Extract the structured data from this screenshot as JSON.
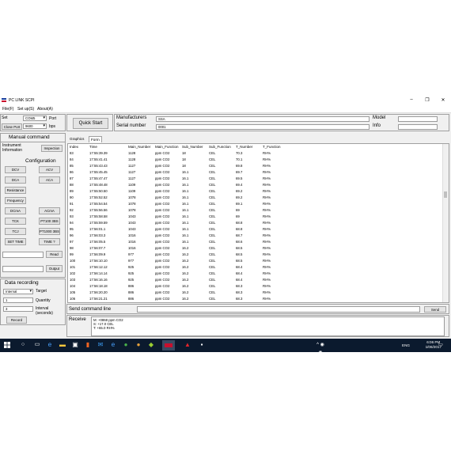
{
  "window": {
    "title": "PC LINK SCPI",
    "controls": [
      "–",
      "❐",
      "✕"
    ]
  },
  "menu": [
    "File(F)",
    "Set up(S)",
    "About(A)"
  ],
  "set_panel": {
    "set_label": "Set",
    "port_value": "COM5",
    "port_label": "Port",
    "close_port_button": "Close Port",
    "baud_value": "9600",
    "bps_label": "bps"
  },
  "quick_start_button": "Quick Start",
  "manufacturers_label": "Manufacturers",
  "manufacturers_value": "SSA",
  "serial_number_label": "Serial number",
  "serial_number_value": "0001",
  "model_label": "Model",
  "model_value": "",
  "info_label": "Info",
  "info_value": "",
  "manual_command": {
    "title": "Manual command",
    "instrument_info_label": "Instrument Information",
    "inspection_button": "Inspection",
    "configuration_title": "Configuration",
    "buttons": [
      "DCV",
      "ACV",
      "DCA",
      "ACA",
      "Resistance",
      "Frequency",
      "DCmA",
      "ACmA",
      "TCK",
      "PT100 3BS",
      "TCJ",
      "PT1000 3BS",
      "SET TIME",
      "TIME ?"
    ],
    "read_button": "Read",
    "output_button": "Output",
    "read_value": "",
    "output_value": ""
  },
  "data_recording": {
    "title": "Data recording",
    "target_value": "Internal",
    "target_label": "Target",
    "quantity_value": "1",
    "quantity_label": "Quantity",
    "interval_value": "3",
    "interval_label": "Interval (seconds)",
    "record_button": "Record"
  },
  "tabs": [
    "Graphics",
    "Form"
  ],
  "active_tab": "Form",
  "table": {
    "columns": [
      "Index",
      "Time",
      "Main_Number",
      "Main_Function",
      "Sub_Number",
      "Sub_Function",
      "T_Number",
      "T_Function"
    ],
    "rows": [
      [
        "83",
        "17:55:39.39",
        "1128",
        "ppm CO2",
        "18",
        "CEL",
        "70.3",
        "RH%"
      ],
      [
        "84",
        "17:55:41.41",
        "1128",
        "ppm CO2",
        "18",
        "CEL",
        "70.1",
        "RH%"
      ],
      [
        "85",
        "17:55:43.43",
        "1127",
        "ppm CO2",
        "18",
        "CEL",
        "69.8",
        "RH%"
      ],
      [
        "86",
        "17:55:45.45",
        "1127",
        "ppm CO2",
        "16.1",
        "CEL",
        "69.7",
        "RH%"
      ],
      [
        "87",
        "17:55:47.47",
        "1127",
        "ppm CO2",
        "16.1",
        "CEL",
        "69.5",
        "RH%"
      ],
      [
        "88",
        "17:55:48.48",
        "1109",
        "ppm CO2",
        "16.1",
        "CEL",
        "69.4",
        "RH%"
      ],
      [
        "89",
        "17:55:50.50",
        "1109",
        "ppm CO2",
        "16.1",
        "CEL",
        "69.2",
        "RH%"
      ],
      [
        "90",
        "17:55:52.52",
        "1078",
        "ppm CO2",
        "16.1",
        "CEL",
        "69.2",
        "RH%"
      ],
      [
        "91",
        "17:55:54.54",
        "1078",
        "ppm CO2",
        "16.1",
        "CEL",
        "69.1",
        "RH%"
      ],
      [
        "92",
        "17:55:56.56",
        "1078",
        "ppm CO2",
        "16.1",
        "CEL",
        "69",
        "RH%"
      ],
      [
        "93",
        "17:55:58.58",
        "1043",
        "ppm CO2",
        "16.1",
        "CEL",
        "69",
        "RH%"
      ],
      [
        "94",
        "17:55:59.59",
        "1043",
        "ppm CO2",
        "16.1",
        "CEL",
        "68.8",
        "RH%"
      ],
      [
        "95",
        "17:56:01.1",
        "1043",
        "ppm CO2",
        "16.1",
        "CEL",
        "68.8",
        "RH%"
      ],
      [
        "96",
        "17:56:03.3",
        "1016",
        "ppm CO2",
        "16.1",
        "CEL",
        "68.7",
        "RH%"
      ],
      [
        "97",
        "17:56:05.5",
        "1016",
        "ppm CO2",
        "16.1",
        "CEL",
        "68.6",
        "RH%"
      ],
      [
        "98",
        "17:56:07.7",
        "1016",
        "ppm CO2",
        "16.2",
        "CEL",
        "68.5",
        "RH%"
      ],
      [
        "99",
        "17:56:09.9",
        "977",
        "ppm CO2",
        "16.2",
        "CEL",
        "68.5",
        "RH%"
      ],
      [
        "100",
        "17:56:10.10",
        "977",
        "ppm CO2",
        "16.2",
        "CEL",
        "68.5",
        "RH%"
      ],
      [
        "101",
        "17:56:12.12",
        "925",
        "ppm CO2",
        "16.2",
        "CEL",
        "68.4",
        "RH%"
      ],
      [
        "102",
        "17:56:14.14",
        "925",
        "ppm CO2",
        "16.2",
        "CEL",
        "68.4",
        "RH%"
      ],
      [
        "103",
        "17:56:16.16",
        "925",
        "ppm CO2",
        "16.2",
        "CEL",
        "68.4",
        "RH%"
      ],
      [
        "104",
        "17:56:18.18",
        "886",
        "ppm CO2",
        "16.2",
        "CEL",
        "68.3",
        "RH%"
      ],
      [
        "105",
        "17:56:20.20",
        "886",
        "ppm CO2",
        "16.2",
        "CEL",
        "68.3",
        "RH%"
      ],
      [
        "106",
        "17:56:21.21",
        "886",
        "ppm CO2",
        "16.2",
        "CEL",
        "68.3",
        "RH%"
      ]
    ]
  },
  "send_command": {
    "label": "Send command line",
    "value": "",
    "send_button": "Send"
  },
  "receive": {
    "label": "Receive",
    "lines": [
      "M: +0868 ppm CO2",
      "S: +17.0 CEL",
      "T: +65.0 RH%"
    ]
  },
  "taskbar": {
    "language": "ENG",
    "time": "6:06 PM",
    "date": "1/06/2017"
  }
}
